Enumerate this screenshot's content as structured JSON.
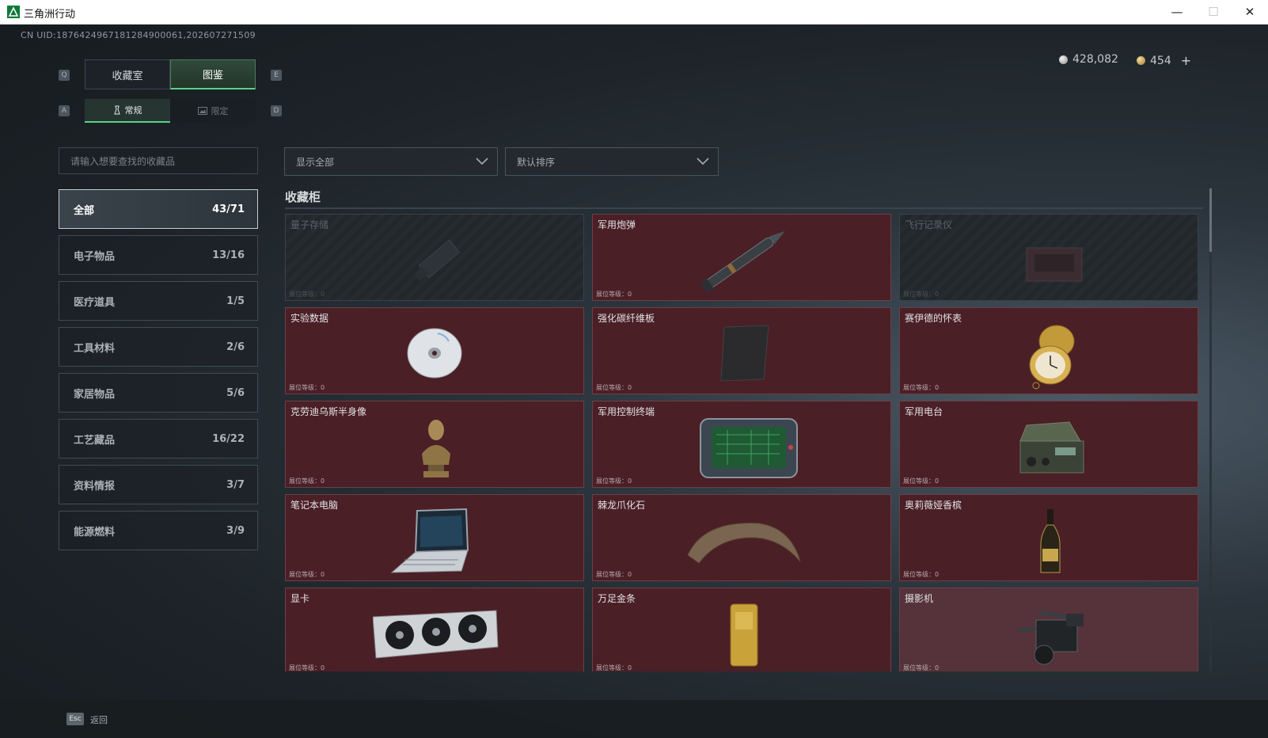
{
  "window": {
    "title": "三角洲行动",
    "minimize_glyph": "—",
    "maximize_glyph": "☐",
    "close_glyph": "✕"
  },
  "account": {
    "uid": "CN UID:1876424967181284900061,202607271509"
  },
  "currency": {
    "silver": "428,082",
    "gold": "454",
    "add_glyph": "+"
  },
  "keys": {
    "prev_main": "Q",
    "next_main": "E",
    "prev_sub": "A",
    "next_sub": "D",
    "back": "Esc"
  },
  "main_tabs": [
    {
      "label": "收藏室",
      "active": false
    },
    {
      "label": "图鉴",
      "active": true
    }
  ],
  "sub_tabs": [
    {
      "label": "常规",
      "icon": "lamp-icon",
      "active": true
    },
    {
      "label": "限定",
      "icon": "picture-icon",
      "active": false
    }
  ],
  "search": {
    "placeholder": "请输入想要查找的收藏品"
  },
  "filters": {
    "display": "显示全部",
    "sort": "默认排序"
  },
  "categories": [
    {
      "label": "全部",
      "count": "43/71",
      "active": true
    },
    {
      "label": "电子物品",
      "count": "13/16"
    },
    {
      "label": "医疗道具",
      "count": "1/5"
    },
    {
      "label": "工具材料",
      "count": "2/6"
    },
    {
      "label": "家居物品",
      "count": "5/6"
    },
    {
      "label": "工艺藏品",
      "count": "16/22"
    },
    {
      "label": "资料情报",
      "count": "3/7"
    },
    {
      "label": "能源燃料",
      "count": "3/9"
    }
  ],
  "section": {
    "title": "收藏柜",
    "level_label": "展位等级：0"
  },
  "items": [
    {
      "name": "量子存储",
      "locked": true,
      "icon": "usb-drive-icon"
    },
    {
      "name": "军用炮弹",
      "locked": false,
      "icon": "artillery-shell-icon"
    },
    {
      "name": "飞行记录仪",
      "locked": true,
      "icon": "flight-recorder-icon"
    },
    {
      "name": "实验数据",
      "locked": false,
      "icon": "disc-icon"
    },
    {
      "name": "强化碳纤维板",
      "locked": false,
      "icon": "carbon-plate-icon"
    },
    {
      "name": "赛伊德的怀表",
      "locked": false,
      "icon": "pocket-watch-icon"
    },
    {
      "name": "克劳迪乌斯半身像",
      "locked": false,
      "icon": "bust-statue-icon"
    },
    {
      "name": "军用控制终端",
      "locked": false,
      "icon": "control-terminal-icon"
    },
    {
      "name": "军用电台",
      "locked": false,
      "icon": "radio-icon"
    },
    {
      "name": "笔记本电脑",
      "locked": false,
      "icon": "laptop-icon"
    },
    {
      "name": "棘龙爪化石",
      "locked": false,
      "icon": "claw-fossil-icon"
    },
    {
      "name": "奥莉薇娅香槟",
      "locked": false,
      "icon": "champagne-icon"
    },
    {
      "name": "显卡",
      "locked": false,
      "icon": "graphics-card-icon"
    },
    {
      "name": "万足金条",
      "locked": false,
      "icon": "gold-bar-icon"
    },
    {
      "name": "摄影机",
      "locked": false,
      "icon": "video-camera-icon"
    }
  ],
  "footer": {
    "back_label": "返回"
  },
  "colors": {
    "accent": "#58d28a",
    "card_bg": "#4b1f26",
    "locked_bg": "#262b30"
  }
}
